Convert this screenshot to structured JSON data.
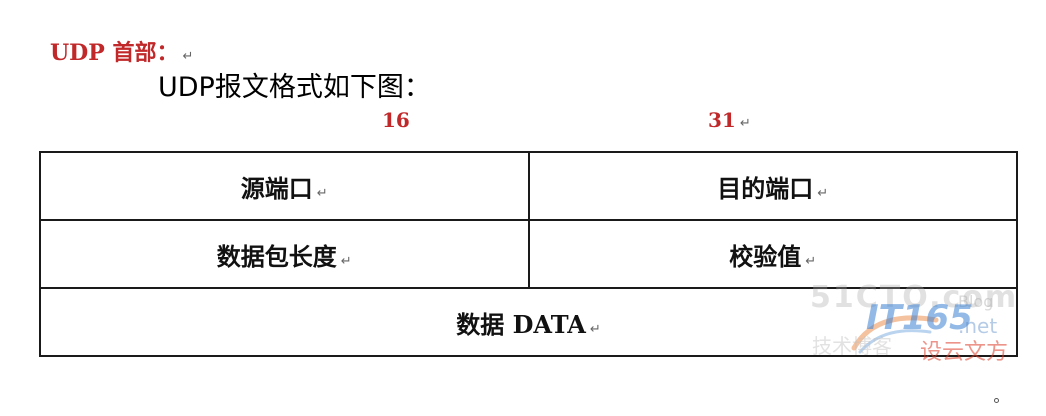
{
  "heading": {
    "text": "UDP 首部：",
    "mark": "↵"
  },
  "caption": "UDP报文格式如下图：",
  "bit_labels": {
    "left": "16",
    "right": "31",
    "right_mark": "↵"
  },
  "table": {
    "rows": [
      [
        {
          "text": "源端口",
          "mark": "↵"
        },
        {
          "text": "目的端口",
          "mark": "↵"
        }
      ],
      [
        {
          "text": "数据包长度",
          "mark": "↵"
        },
        {
          "text": "校验值",
          "mark": "↵"
        }
      ],
      [
        {
          "text": "数据 DATA",
          "mark": "↵"
        }
      ]
    ]
  },
  "watermark": {
    "site": "51CTO.com",
    "brand": "IT165",
    "suffix": ".net",
    "blog": "Blog",
    "line2": "技术博客",
    "line2_red": "设云文方"
  },
  "colors": {
    "heading": "#c0282a",
    "bit_labels": "#c0282a",
    "text": "#111111",
    "border": "#1a1a1a"
  }
}
